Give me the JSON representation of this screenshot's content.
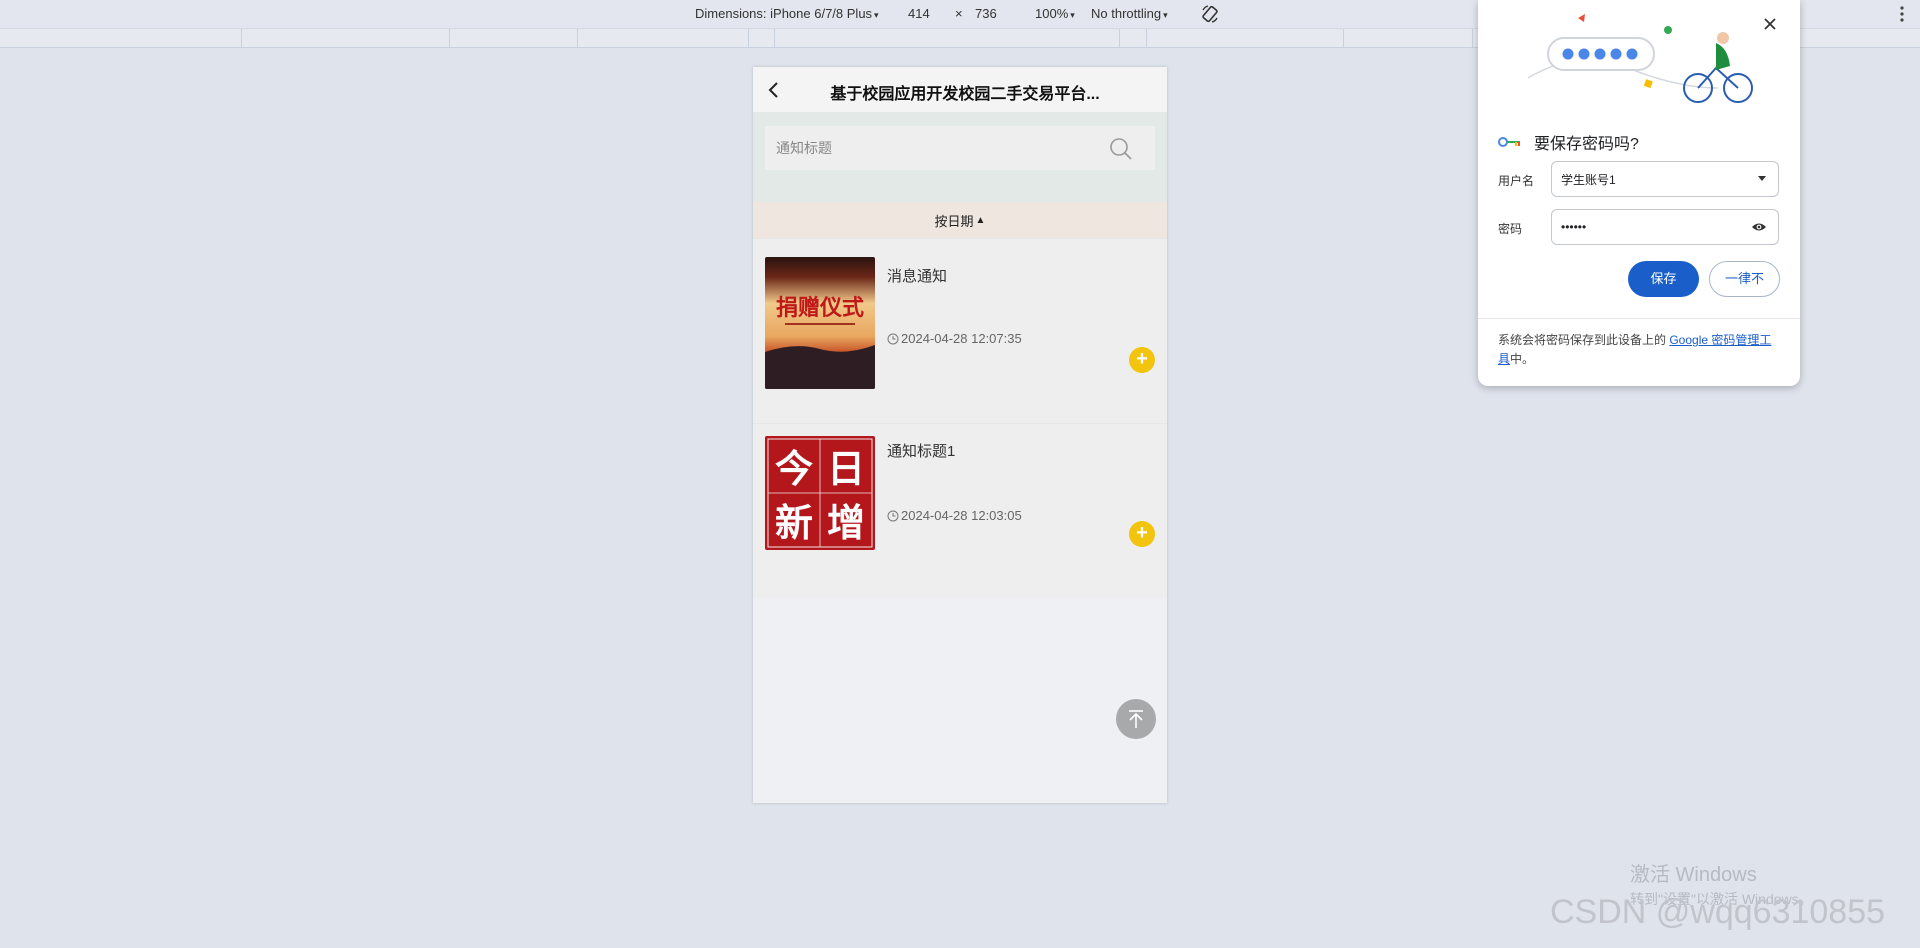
{
  "devtools": {
    "dimensions_label": "Dimensions: iPhone 6/7/8 Plus",
    "width": "414",
    "times": "×",
    "height": "736",
    "zoom": "100%",
    "throttling": "No throttling",
    "caret": "▾"
  },
  "app": {
    "title": "基于校园应用开发校园二手交易平台...",
    "search_placeholder": "通知标题",
    "sort_label": "按日期",
    "sort_arrow": "▲",
    "items": [
      {
        "title": "消息通知",
        "time": "2024-04-28 12:07:35",
        "thumb_text": "捐赠仪式"
      },
      {
        "title": "通知标题1",
        "time": "2024-04-28 12:03:05",
        "thumb_chars": [
          "今",
          "日",
          "新",
          "增"
        ]
      }
    ],
    "plus": "+"
  },
  "password_popup": {
    "heading": "要保存密码吗?",
    "username_label": "用户名",
    "username_value": "学生账号1",
    "password_label": "密码",
    "password_value": "••••••",
    "save_button": "保存",
    "never_button": "一律不",
    "footer_prefix": "系统会将密码保存到此设备上的 ",
    "footer_link": "Google 密码管理工具",
    "footer_suffix": "中。"
  },
  "overlay": {
    "windows_line1": "激活 Windows",
    "windows_line2": "转到\"设置\"以激活 Windows。",
    "csdn": "CSDN @wqq6310855"
  },
  "colors": {
    "accent_yellow": "#f2c40e",
    "save_blue": "#1a5ec9"
  }
}
